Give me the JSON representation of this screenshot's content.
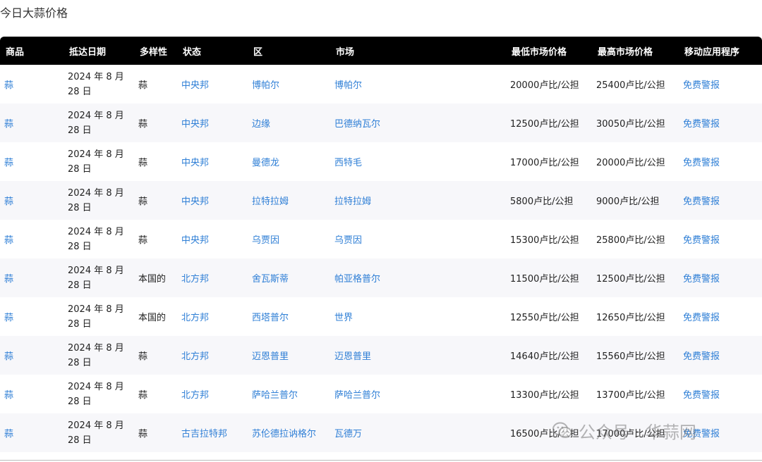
{
  "page": {
    "title": "今日大蒜价格"
  },
  "table": {
    "headers": [
      "商品",
      "抵达日期",
      "多样性",
      "状态",
      "区",
      "市场",
      "最低市场价格",
      "最高市场价格",
      "移动应用程序"
    ],
    "rows": [
      {
        "commodity": "蒜",
        "date_line1": "2024 年 8 月",
        "date_line2": "28 日",
        "variety": "蒜",
        "state": "中央邦",
        "district": "博帕尔",
        "market": "博帕尔",
        "min_price": "20000卢比/公担",
        "max_price": "25400卢比/公担",
        "app": "免费警报"
      },
      {
        "commodity": "蒜",
        "date_line1": "2024 年 8 月",
        "date_line2": "28 日",
        "variety": "蒜",
        "state": "中央邦",
        "district": "边缘",
        "market": "巴德纳瓦尔",
        "min_price": "12500卢比/公担",
        "max_price": "30050卢比/公担",
        "app": "免费警报"
      },
      {
        "commodity": "蒜",
        "date_line1": "2024 年 8 月",
        "date_line2": "28 日",
        "variety": "蒜",
        "state": "中央邦",
        "district": "曼德龙",
        "market": "西特毛",
        "min_price": "17000卢比/公担",
        "max_price": "20000卢比/公担",
        "app": "免费警报"
      },
      {
        "commodity": "蒜",
        "date_line1": "2024 年 8 月",
        "date_line2": "28 日",
        "variety": "蒜",
        "state": "中央邦",
        "district": "拉特拉姆",
        "market": "拉特拉姆",
        "min_price": "5800卢比/公担",
        "max_price": "9000卢比/公担",
        "app": "免费警报"
      },
      {
        "commodity": "蒜",
        "date_line1": "2024 年 8 月",
        "date_line2": "28 日",
        "variety": "蒜",
        "state": "中央邦",
        "district": "乌贾因",
        "market": "乌贾因",
        "min_price": "15300卢比/公担",
        "max_price": "25800卢比/公担",
        "app": "免费警报"
      },
      {
        "commodity": "蒜",
        "date_line1": "2024 年 8 月",
        "date_line2": "28 日",
        "variety": "本国的",
        "state": "北方邦",
        "district": "舍瓦斯蒂",
        "market": "帕亚格普尔",
        "min_price": "11500卢比/公担",
        "max_price": "12500卢比/公担",
        "app": "免费警报"
      },
      {
        "commodity": "蒜",
        "date_line1": "2024 年 8 月",
        "date_line2": "28 日",
        "variety": "本国的",
        "state": "北方邦",
        "district": "西塔普尔",
        "market": "世界",
        "min_price": "12550卢比/公担",
        "max_price": "12650卢比/公担",
        "app": "免费警报"
      },
      {
        "commodity": "蒜",
        "date_line1": "2024 年 8 月",
        "date_line2": "28 日",
        "variety": "蒜",
        "state": "北方邦",
        "district": "迈恩普里",
        "market": "迈恩普里",
        "min_price": "14640卢比/公担",
        "max_price": "15560卢比/公担",
        "app": "免费警报"
      },
      {
        "commodity": "蒜",
        "date_line1": "2024 年 8 月",
        "date_line2": "28 日",
        "variety": "蒜",
        "state": "北方邦",
        "district": "萨哈兰普尔",
        "market": "萨哈兰普尔",
        "min_price": "13300卢比/公担",
        "max_price": "13700卢比/公担",
        "app": "免费警报"
      },
      {
        "commodity": "蒜",
        "date_line1": "2024 年 8 月",
        "date_line2": "28 日",
        "variety": "蒜",
        "state": "古吉拉特邦",
        "district": "苏伦德拉讷格尔",
        "market": "瓦德万",
        "min_price": "16500卢比/公担",
        "max_price": "17000卢比/公担",
        "app": "免费警报"
      }
    ]
  },
  "watermark": {
    "text": "公众号 · 华蒜网",
    "icon": "wechat-icon"
  },
  "colors": {
    "header_bg": "#000000",
    "header_text": "#ffffff",
    "link": "#2f7fd6",
    "row_alt": "#f7f7fa"
  }
}
